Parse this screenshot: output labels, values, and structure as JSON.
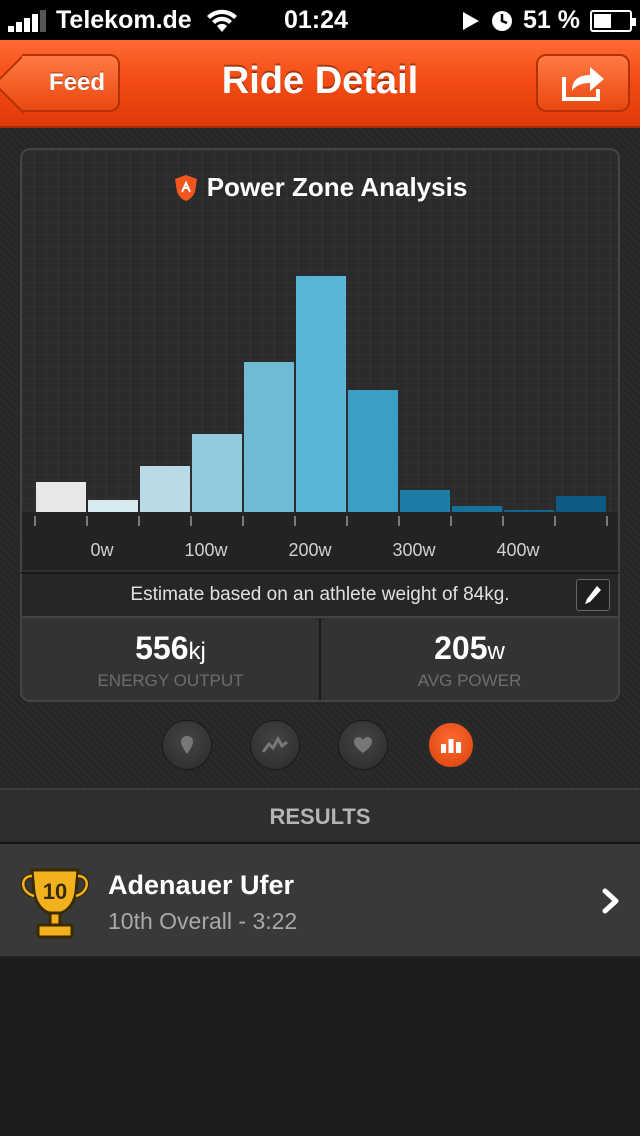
{
  "status_bar": {
    "carrier": "Telekom.de",
    "time": "01:24",
    "battery": "51 %",
    "battery_level": 0.51
  },
  "nav": {
    "back_label": "Feed",
    "title": "Ride Detail"
  },
  "chart_data": {
    "type": "bar",
    "title": "Power Zone Analysis",
    "xlabel": "",
    "ylabel": "",
    "x_tick_labels": [
      "0w",
      "100w",
      "200w",
      "300w",
      "400w"
    ],
    "bin_width_w": 50,
    "bin_starts": [
      -50,
      0,
      50,
      100,
      150,
      200,
      250,
      300,
      350,
      400,
      450
    ],
    "values": [
      30,
      12,
      46,
      78,
      150,
      236,
      122,
      22,
      6,
      2,
      16
    ],
    "ylim": [
      0,
      250
    ],
    "colors": [
      "#e8e8e8",
      "#d6eaf0",
      "#b9dbe6",
      "#93c9dc",
      "#6fbad4",
      "#5ab6d6",
      "#3b9ec4",
      "#1c7ea8",
      "#16729a",
      "#116690",
      "#0e5a86"
    ],
    "grid": true
  },
  "weight_note": "Estimate based on an athlete weight of 84kg.",
  "stats": {
    "energy_value": "556",
    "energy_unit": "kj",
    "energy_label": "ENERGY OUTPUT",
    "power_value": "205",
    "power_unit": "w",
    "power_label": "AVG POWER"
  },
  "page_dots": {
    "items": [
      "map-pin-icon",
      "elevation-icon",
      "heart-icon",
      "bar-chart-icon"
    ],
    "active_index": 3
  },
  "results": {
    "header": "RESULTS",
    "items": [
      {
        "trophy_number": "10",
        "name": "Adenauer Ufer",
        "rank": "10th Overall - 3:22"
      }
    ]
  },
  "colors": {
    "accent": "#f24a12",
    "trophy": "#f1b21e"
  }
}
